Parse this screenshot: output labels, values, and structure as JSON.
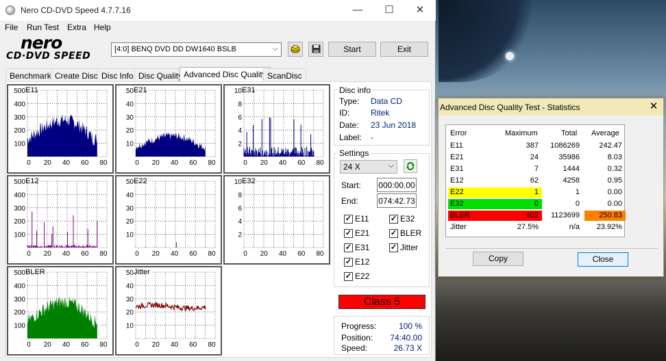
{
  "window": {
    "title": "Nero CD-DVD Speed 4.7.7.16",
    "minimize": "—",
    "maximize": "☐",
    "close": "✕"
  },
  "menu": [
    "File",
    "Run Test",
    "Extra",
    "Help"
  ],
  "logo": {
    "top": "nero",
    "bottom": "CD·DVD SPEED"
  },
  "toolbar": {
    "drive": "[4:0]   BENQ DVD DD DW1640 BSLB",
    "start_label": "Start",
    "exit_label": "Exit"
  },
  "tabs": [
    "Benchmark",
    "Create Disc",
    "Disc Info",
    "Disc Quality",
    "Advanced Disc Quality",
    "ScanDisc"
  ],
  "active_tab": "Advanced Disc Quality",
  "charts": [
    {
      "name": "E11",
      "yticks": [
        "500",
        "400",
        "300",
        "200",
        "100"
      ],
      "ymax": 500,
      "color": "#000080",
      "style": "fill",
      "profile": "hump",
      "level": 300,
      "xticks": [
        "0",
        "20",
        "40",
        "60",
        "80"
      ]
    },
    {
      "name": "E21",
      "yticks": [
        "50",
        "40",
        "30",
        "20",
        "10"
      ],
      "ymax": 50,
      "color": "#000080",
      "style": "fill",
      "profile": "hump",
      "level": 17,
      "xticks": [
        "0",
        "20",
        "40",
        "60",
        "80"
      ]
    },
    {
      "name": "E31",
      "yticks": [
        "10",
        "8",
        "6",
        "4",
        "2"
      ],
      "ymax": 10,
      "color": "#000080",
      "style": "spikes",
      "level": 1.5,
      "xticks": [
        "0",
        "20",
        "40",
        "60",
        "80"
      ]
    },
    {
      "name": "E12",
      "yticks": [
        "500",
        "400",
        "300",
        "200",
        "100"
      ],
      "ymax": 500,
      "color": "#800080",
      "style": "spikes",
      "level": 20,
      "xticks": [
        "0",
        "20",
        "40",
        "60",
        "80"
      ]
    },
    {
      "name": "E22",
      "yticks": [
        "50",
        "40",
        "30",
        "20",
        "10"
      ],
      "ymax": 50,
      "color": "#800080",
      "style": "spikes",
      "level": 0,
      "xticks": [
        "0",
        "20",
        "40",
        "60",
        "80"
      ]
    },
    {
      "name": "E32",
      "yticks": [
        "10",
        "8",
        "6",
        "4",
        "2"
      ],
      "ymax": 10,
      "color": "#800080",
      "style": "none",
      "level": 0,
      "xticks": [
        "0",
        "20",
        "40",
        "60",
        "80"
      ]
    },
    {
      "name": "BLER",
      "yticks": [
        "500",
        "400",
        "300",
        "200",
        "100"
      ],
      "ymax": 500,
      "color": "#008000",
      "style": "fill",
      "profile": "hump",
      "level": 300,
      "xticks": [
        "0",
        "20",
        "40",
        "60",
        "80"
      ]
    },
    {
      "name": "Jitter",
      "yticks": [
        "50",
        "40",
        "30",
        "20",
        "10"
      ],
      "ymax": 50,
      "color": "#800000",
      "style": "line",
      "level": 24,
      "xticks": [
        "0",
        "20",
        "40",
        "60",
        "80"
      ]
    }
  ],
  "disc_info": {
    "title": "Disc info",
    "type_label": "Type:",
    "type": "Data CD",
    "id_label": "ID:",
    "id": "Ritek",
    "date_label": "Date:",
    "date": "23 Jun 2018",
    "label_label": "Label:",
    "label": "-"
  },
  "settings": {
    "title": "Settings",
    "speed": "24 X",
    "start_label": "Start:",
    "start": "000:00.00",
    "end_label": "End:",
    "end": "074:42.73",
    "checks": [
      "E11",
      "E32",
      "E21",
      "BLER",
      "E31",
      "Jitter",
      "E12",
      "E22"
    ]
  },
  "class_label": "Class 5",
  "progress": {
    "progress_label": "Progress:",
    "progress": "100 %",
    "position_label": "Position:",
    "position": "74:40.00",
    "speed_label": "Speed:",
    "speed": "26.73 X"
  },
  "stats": {
    "title": "Advanced Disc Quality Test - Statistics",
    "close": "✕",
    "headers": [
      "Error",
      "Maximum",
      "Total",
      "Average"
    ],
    "rows": [
      {
        "error": "E11",
        "max": "387",
        "total": "1086269",
        "avg": "242.47"
      },
      {
        "error": "E21",
        "max": "24",
        "total": "35986",
        "avg": "8.03"
      },
      {
        "error": "E31",
        "max": "7",
        "total": "1444",
        "avg": "0.32"
      },
      {
        "error": "E12",
        "max": "62",
        "total": "4258",
        "avg": "0.95"
      },
      {
        "error": "E22",
        "max": "1",
        "total": "1",
        "avg": "0.00"
      },
      {
        "error": "E32",
        "max": "0",
        "total": "0",
        "avg": "0.00"
      },
      {
        "error": "BLER",
        "max": "402",
        "total": "1123699",
        "avg": "250.83"
      },
      {
        "error": "Jitter",
        "max": "27.5%",
        "total": "n/a",
        "avg": "23.92%"
      }
    ],
    "copy_label": "Copy",
    "close_label": "Close",
    "colors": {
      "E22": "#ffff00",
      "E32": "#00e000",
      "BLER": "#ff0000",
      "bler_avg": "#ff8000"
    }
  }
}
